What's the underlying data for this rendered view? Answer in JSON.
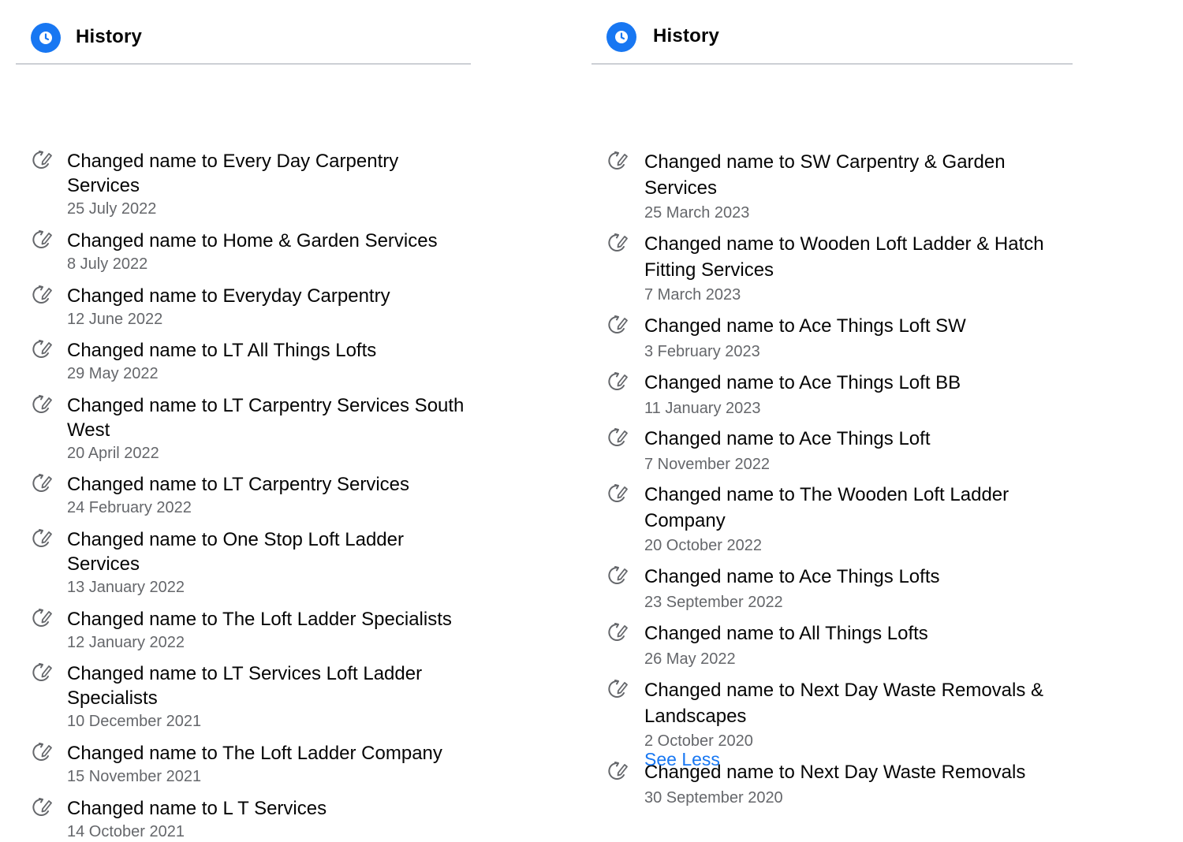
{
  "left_panel": {
    "title": "History",
    "items": [
      {
        "prefix": "Changed name to ",
        "name": "Every Day Carpentry Services",
        "date": "25 July 2022"
      },
      {
        "prefix": "Changed name to ",
        "name": "Home & Garden Services",
        "date": "8 July 2022"
      },
      {
        "prefix": "Changed name to ",
        "name": "Everyday Carpentry",
        "date": "12 June 2022"
      },
      {
        "prefix": "Changed name to ",
        "name": "LT All Things Lofts",
        "date": "29 May 2022"
      },
      {
        "prefix": "Changed name to ",
        "name": "LT Carpentry Services South West",
        "date": "20 April 2022"
      },
      {
        "prefix": "Changed name to ",
        "name": "LT Carpentry Services",
        "date": "24 February 2022"
      },
      {
        "prefix": "Changed name to ",
        "name": "One Stop Loft Ladder Services",
        "date": "13 January 2022"
      },
      {
        "prefix": "Changed name to ",
        "name": "The Loft Ladder Specialists",
        "date": "12 January 2022"
      },
      {
        "prefix": "Changed name to ",
        "name": "LT Services Loft Ladder Specialists",
        "date": "10 December 2021"
      },
      {
        "prefix": "Changed name to ",
        "name": "The Loft Ladder Company",
        "date": "15 November 2021"
      },
      {
        "prefix": "Changed name to ",
        "name": "L T Services",
        "date": "14 October 2021"
      }
    ]
  },
  "right_panel": {
    "title": "History",
    "items": [
      {
        "prefix": "Changed name to ",
        "name": "SW Carpentry & Garden Services",
        "date": "25 March 2023"
      },
      {
        "prefix": "Changed name to ",
        "name": "Wooden Loft Ladder & Hatch Fitting Services",
        "date": "7 March 2023"
      },
      {
        "prefix": "Changed name to ",
        "name": "Ace Things Loft SW",
        "date": "3 February 2023"
      },
      {
        "prefix": "Changed name to ",
        "name": "Ace Things Loft BB",
        "date": "11 January 2023"
      },
      {
        "prefix": "Changed name to ",
        "name": "Ace Things Loft",
        "date": "7 November 2022"
      },
      {
        "prefix": "Changed name to ",
        "name": "The Wooden Loft Ladder Company",
        "date": "20 October 2022"
      },
      {
        "prefix": "Changed name to ",
        "name": "Ace Things Lofts",
        "date": "23 September 2022"
      },
      {
        "prefix": "Changed name to ",
        "name": "All Things Lofts",
        "date": "26 May 2022"
      },
      {
        "prefix": "Changed name to ",
        "name": "Next Day Waste Removals & Landscapes",
        "date": "2 October 2020"
      },
      {
        "prefix": "Changed name to ",
        "name": "Next Day Waste Removals",
        "date": "30 September 2020"
      }
    ],
    "see_less_label": "See Less"
  },
  "icons": {
    "header_icon": "clock-icon",
    "item_icon": "edit-history-icon"
  },
  "colors": {
    "accent": "#1877f2",
    "secondary_text": "#65676b",
    "divider": "#ccd0d5"
  }
}
